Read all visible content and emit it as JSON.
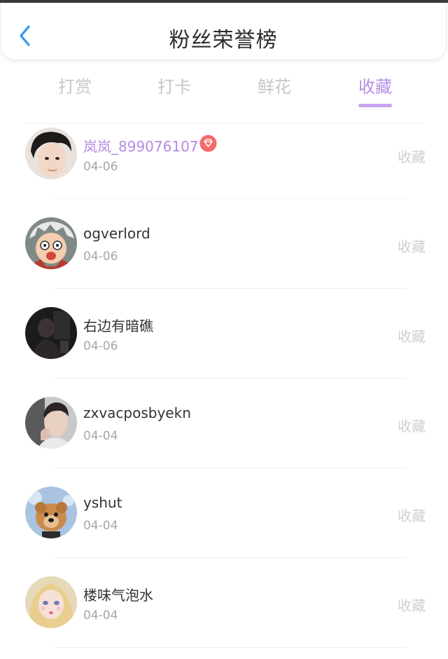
{
  "header": {
    "title": "粉丝荣誉榜",
    "back_icon": "chevron-left-icon",
    "accent_color": "#2f97f3"
  },
  "tabs": [
    {
      "label": "打赏",
      "active": false
    },
    {
      "label": "打卡",
      "active": false
    },
    {
      "label": "鲜花",
      "active": false
    },
    {
      "label": "收藏",
      "active": true
    }
  ],
  "active_tab_color": "#b78ee6",
  "fans": [
    {
      "name": "岚岚_899076107",
      "date": "04-06",
      "action": "收藏",
      "highlight": true,
      "badge": "diamond-badge-icon",
      "avatar": "avatar-young-man"
    },
    {
      "name": "ogverlord",
      "date": "04-06",
      "action": "收藏",
      "highlight": false,
      "avatar": "avatar-cartoon"
    },
    {
      "name": "右边有暗礁",
      "date": "04-06",
      "action": "收藏",
      "highlight": false,
      "avatar": "avatar-dark-photo"
    },
    {
      "name": "zxvacposbyekn",
      "date": "04-04",
      "action": "收藏",
      "highlight": false,
      "avatar": "avatar-man-portrait"
    },
    {
      "name": "yshut",
      "date": "04-04",
      "action": "收藏",
      "highlight": false,
      "avatar": "avatar-puppy"
    },
    {
      "name": "楼味气泡水",
      "date": "04-04",
      "action": "收藏",
      "highlight": false,
      "avatar": "avatar-anime-girl"
    }
  ]
}
